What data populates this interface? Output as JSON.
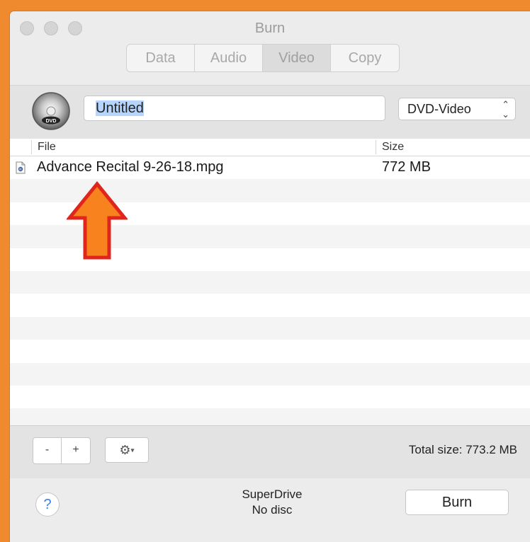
{
  "window": {
    "title": "Burn",
    "tabs": [
      {
        "label": "Data"
      },
      {
        "label": "Audio"
      },
      {
        "label": "Video"
      },
      {
        "label": "Copy"
      }
    ],
    "active_tab": "Video"
  },
  "disc": {
    "icon": "dvd-disc-icon",
    "name_value": "Untitled",
    "type_selected": "DVD-Video"
  },
  "table": {
    "headers": {
      "file": "File",
      "size": "Size"
    },
    "rows": [
      {
        "name": "Advance Recital 9-26-18.mpg",
        "size": "772 MB"
      }
    ]
  },
  "toolbar": {
    "remove_label": "-",
    "add_label": "+",
    "gear_icon": "gear-icon",
    "total_size": "Total size: 773.2 MB"
  },
  "footer": {
    "help_label": "?",
    "drive_name": "SuperDrive",
    "drive_status": "No disc",
    "burn_label": "Burn"
  },
  "colors": {
    "background_frame": "#f08a2e",
    "annotation_arrow_fill": "#f7821e",
    "annotation_arrow_stroke": "#e0261c"
  }
}
